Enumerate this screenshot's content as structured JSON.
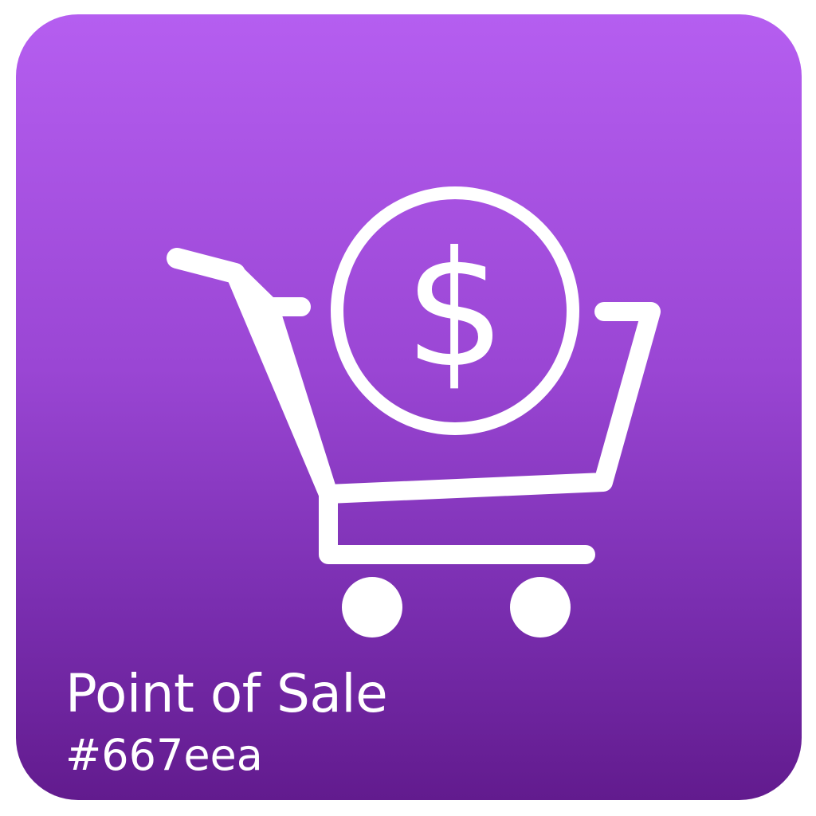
{
  "tile": {
    "title": "Point of Sale",
    "color_code": "#667eea",
    "icon": "shopping-cart-dollar-icon"
  },
  "colors": {
    "gradient_top": "#b55ef0",
    "gradient_bottom": "#621b8e",
    "foreground": "#ffffff"
  }
}
